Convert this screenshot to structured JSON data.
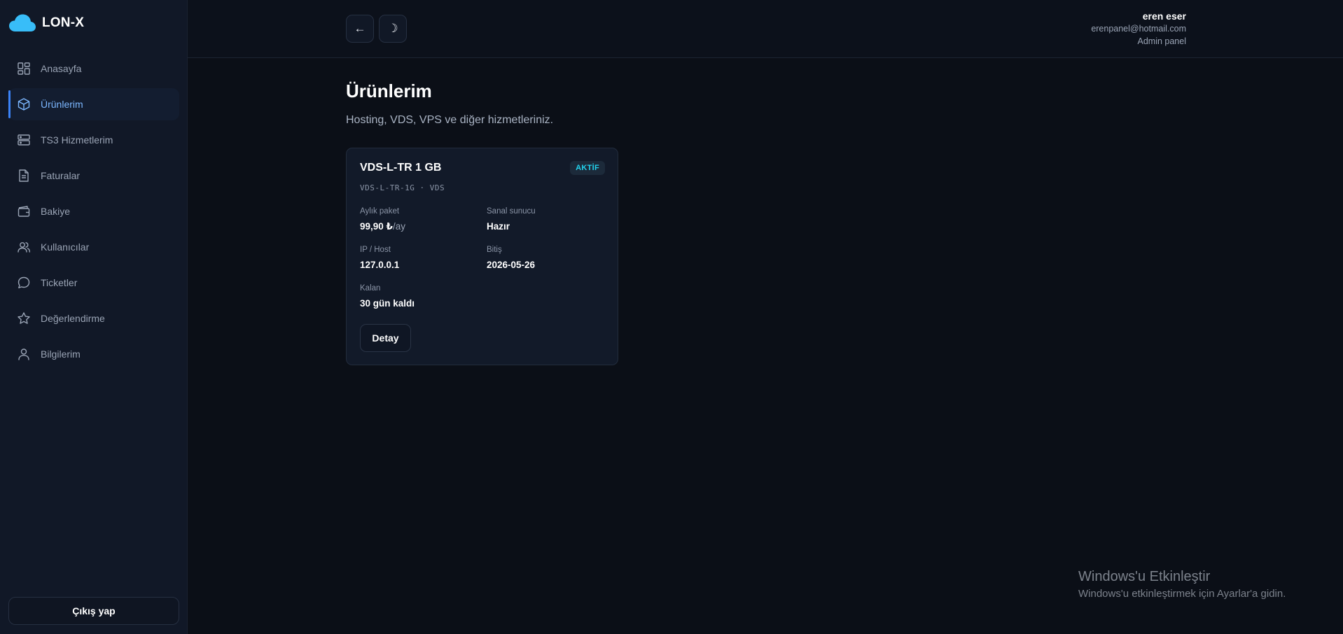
{
  "brand": {
    "name": "LON-X",
    "icon": "cloud-icon",
    "icon_color": "#38bdf8"
  },
  "sidebar": {
    "items": [
      {
        "label": "Anasayfa",
        "icon": "dashboard-grid-icon",
        "active": false
      },
      {
        "label": "Ürünlerim",
        "icon": "box-icon",
        "active": true
      },
      {
        "label": "TS3 Hizmetlerim",
        "icon": "server-icon",
        "active": false
      },
      {
        "label": "Faturalar",
        "icon": "document-icon",
        "active": false
      },
      {
        "label": "Bakiye",
        "icon": "wallet-icon",
        "active": false
      },
      {
        "label": "Kullanıcılar",
        "icon": "users-icon",
        "active": false
      },
      {
        "label": "Ticketler",
        "icon": "chat-bubble-icon",
        "active": false
      },
      {
        "label": "Değerlendirme",
        "icon": "star-icon",
        "active": false
      },
      {
        "label": "Bilgilerim",
        "icon": "user-icon",
        "active": false
      }
    ],
    "logout_label": "Çıkış yap"
  },
  "topbar": {
    "back_label": "←",
    "theme_label": "☽",
    "user": {
      "name": "eren eser",
      "email": "erenpanel@hotmail.com",
      "role": "Admin panel"
    }
  },
  "main": {
    "title": "Ürünlerim",
    "subtitle": "Hosting, VDS, VPS ve diğer hizmetleriniz.",
    "products": [
      {
        "name": "VDS-L-TR 1 GB",
        "code": "VDS-L-TR-1G · VDS",
        "status": "AKTİF",
        "status_color": "#22d3ee",
        "monthly_label": "Aylık paket",
        "price": "99,90 ₺",
        "price_unit": "/ay",
        "server_label": "Sanal sunucu",
        "server_status": "Hazır",
        "ip_label": "IP / Host",
        "ip": "127.0.0.1",
        "end_label": "Bitiş",
        "end_date": "2026-05-26",
        "remaining_label": "Kalan",
        "remaining": "30 gün kaldı",
        "detail_label": "Detay"
      }
    ]
  },
  "watermark": {
    "title": "Windows'u Etkinleştir",
    "subtitle": "Windows'u etkinleştirmek için Ayarlar'a gidin."
  },
  "colors": {
    "background": "#0b0f17",
    "sidebar": "#111827",
    "accent": "#3b82f6",
    "card": "#121a29"
  }
}
